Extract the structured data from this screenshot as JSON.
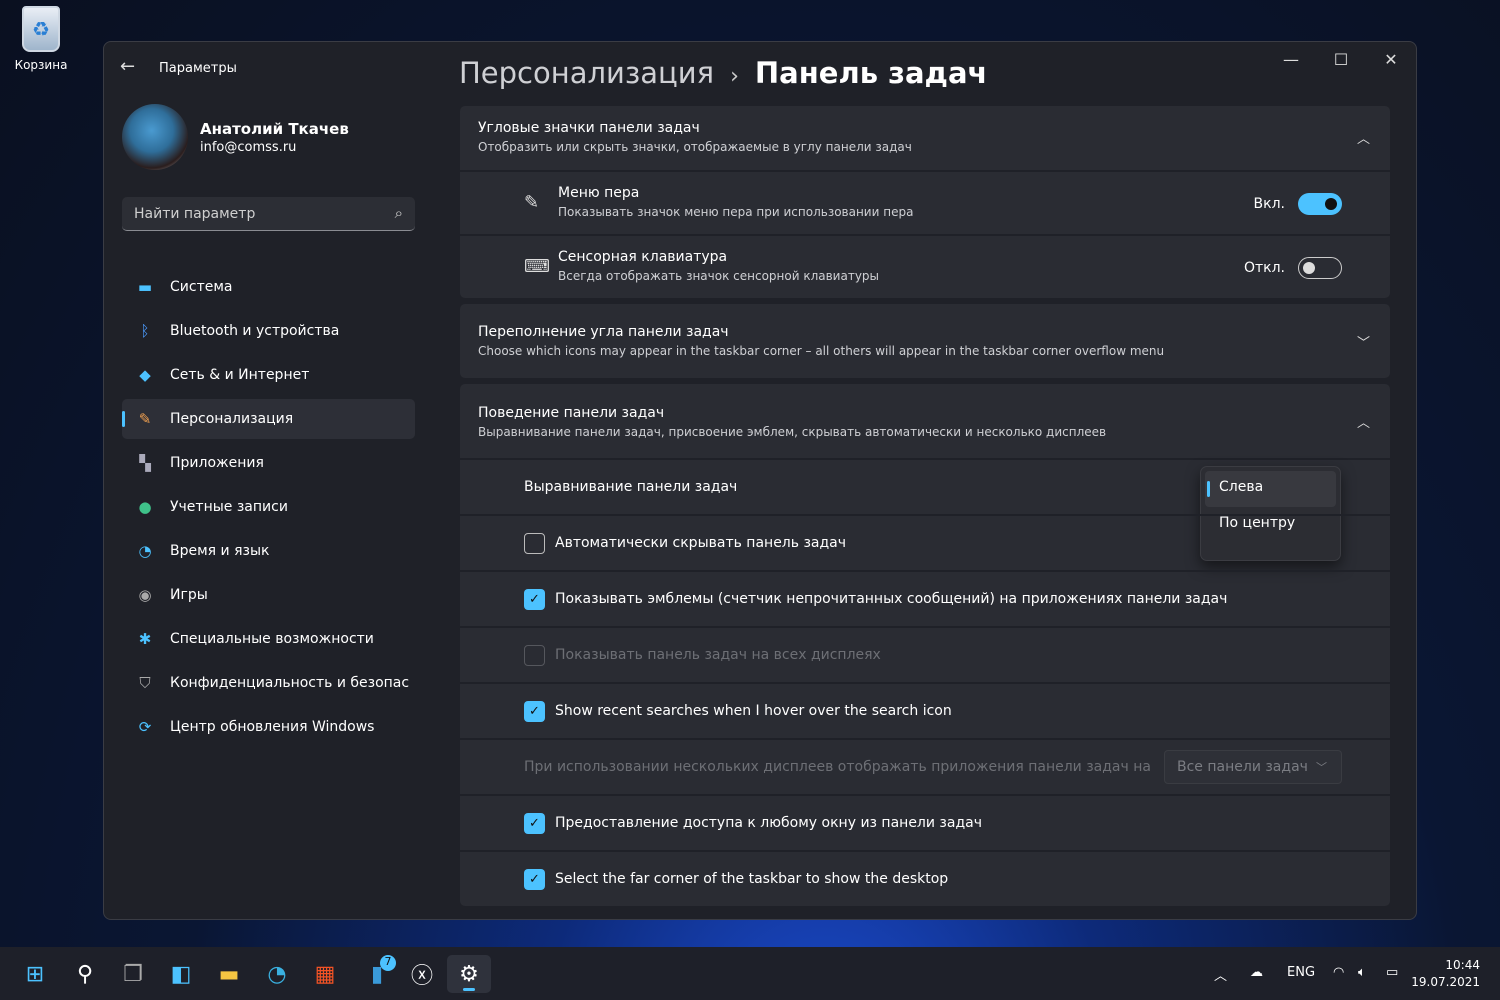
{
  "desktop": {
    "recycle_bin": "Корзина"
  },
  "window": {
    "app_title": "Параметры"
  },
  "user": {
    "name": "Анатолий Ткачев",
    "email": "info@comss.ru"
  },
  "search": {
    "placeholder": "Найти параметр"
  },
  "sidebar": {
    "items": [
      {
        "label": "Система",
        "icon": "monitor-icon"
      },
      {
        "label": "Bluetooth и устройства",
        "icon": "bluetooth-icon"
      },
      {
        "label": "Сеть & и Интернет",
        "icon": "wifi-icon"
      },
      {
        "label": "Персонализация",
        "icon": "brush-icon",
        "active": true
      },
      {
        "label": "Приложения",
        "icon": "apps-icon"
      },
      {
        "label": "Учетные записи",
        "icon": "person-icon"
      },
      {
        "label": "Время и язык",
        "icon": "clock-icon"
      },
      {
        "label": "Игры",
        "icon": "gamepad-icon"
      },
      {
        "label": "Специальные возможности",
        "icon": "accessibility-icon"
      },
      {
        "label": "Конфиденциальность и безопас",
        "icon": "shield-icon"
      },
      {
        "label": "Центр обновления Windows",
        "icon": "update-icon"
      }
    ]
  },
  "breadcrumb": {
    "parent": "Персонализация",
    "sep": "›",
    "current": "Панель задач"
  },
  "corner_icons": {
    "title": "Угловые значки панели задач",
    "subtitle": "Отобразить или скрыть значки, отображаемые в углу панели задач",
    "items": [
      {
        "title": "Меню пера",
        "subtitle": "Показывать значок меню пера при использовании пера",
        "state": "Вкл.",
        "on": true
      },
      {
        "title": "Сенсорная клавиатура",
        "subtitle": "Всегда отображать значок сенсорной клавиатуры",
        "state": "Откл.",
        "on": false
      }
    ]
  },
  "overflow": {
    "title": "Переполнение угла панели задач",
    "subtitle": "Choose which icons may appear in the taskbar corner – all others will appear in the taskbar corner overflow menu"
  },
  "behavior": {
    "title": "Поведение панели задач",
    "subtitle": "Выравнивание панели задач, присвоение эмблем, скрывать автоматически и несколько дисплеев",
    "alignment_label": "Выравнивание панели задач",
    "alignment_options": [
      "Слева",
      "По центру"
    ],
    "checks": [
      {
        "label": "Автоматически скрывать панель задач",
        "checked": false
      },
      {
        "label": "Показывать эмблемы (счетчик непрочитанных сообщений) на приложениях панели задач",
        "checked": true
      },
      {
        "label": "Показывать панель задач на всех дисплеях",
        "checked": false,
        "disabled": true
      },
      {
        "label": "Show recent searches when I hover over the search icon",
        "checked": true
      }
    ],
    "multi_label": "При использовании нескольких дисплеев отображать приложения панели задач на",
    "multi_value": "Все панели задач",
    "checks2": [
      {
        "label": "Предоставление доступа к любому окну из панели задач",
        "checked": true
      },
      {
        "label": "Select the far corner of the taskbar to show the desktop",
        "checked": true
      }
    ]
  },
  "taskbar": {
    "badge": "7",
    "lang": "ENG",
    "time": "10:44",
    "date": "19.07.2021"
  },
  "colors": {
    "accent": "#4cc2ff"
  }
}
